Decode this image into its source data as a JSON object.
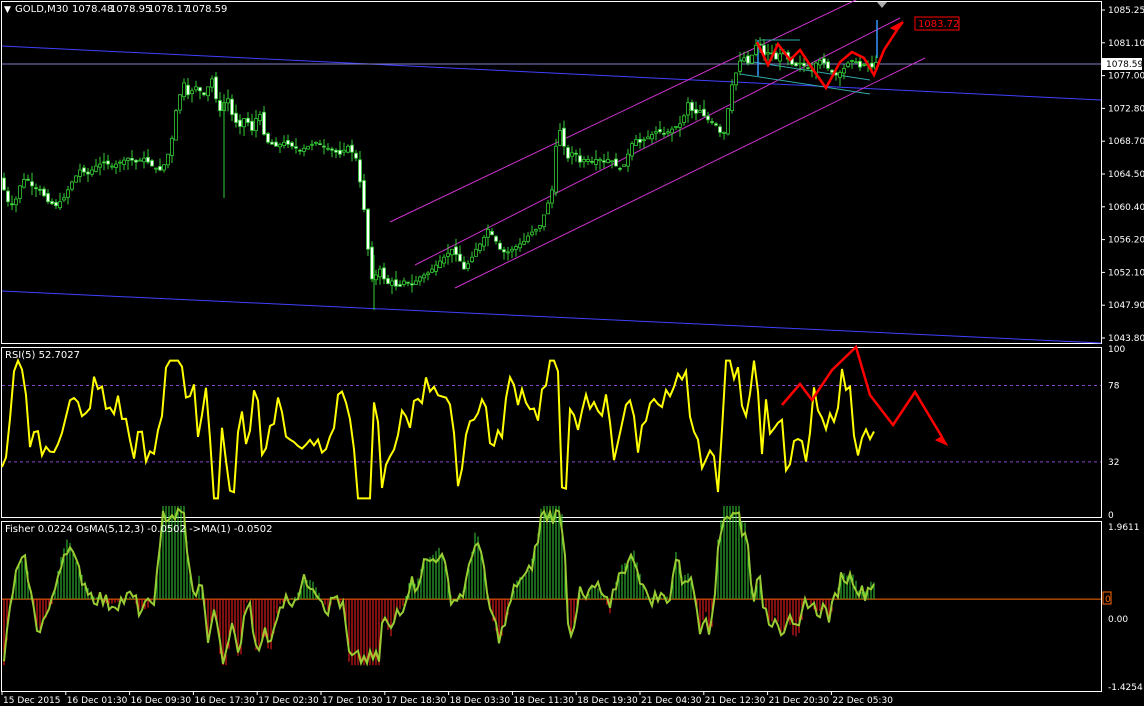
{
  "colors": {
    "background": "#000000",
    "frame": "#ffffff",
    "bull_candle": "#33cc33",
    "bear_candle": "#ffffff",
    "trendline": "#4040ff",
    "channel": "#cc33cc",
    "flag": "#33aaaa",
    "current_price_line": "#8080cc",
    "annotation_red": "#ff0000",
    "rsi_line": "#ffff00",
    "rsi_level": "#8844cc",
    "hist_positive": "#33cc33",
    "hist_negative": "#ff2020",
    "fisher_line": "#99cc33",
    "zero_line": "#ff6a00",
    "text": "#ffffff",
    "target_box_border": "#ff0000"
  },
  "chart_data": [
    {
      "type": "candlestick",
      "title": "GOLD,M30",
      "ohlc_header": [
        "1078.48",
        "1078.95",
        "1078.17",
        "1078.59"
      ],
      "current_price_label": "1078.59",
      "target_label": "1083.72",
      "ylim": [
        1043.8,
        1085.2
      ],
      "y_ticks": [
        "1085.25",
        "1081.10",
        "1077.00",
        "1072.80",
        "1068.70",
        "1064.50",
        "1060.40",
        "1056.20",
        "1052.10",
        "1047.90",
        "1043.80"
      ],
      "x_ticks": [
        "15 Dec 2015",
        "16 Dec 01:30",
        "16 Dec 09:30",
        "16 Dec 17:30",
        "17 Dec 02:30",
        "17 Dec 10:30",
        "17 Dec 18:30",
        "18 Dec 03:30",
        "18 Dec 11:30",
        "18 Dec 19:30",
        "21 Dec 04:30",
        "21 Dec 12:30",
        "21 Dec 20:30",
        "22 Dec 05:30"
      ],
      "close_path": [
        [
          0,
          1064.0
        ],
        [
          8,
          1061.0
        ],
        [
          14,
          1060.5
        ],
        [
          20,
          1063.0
        ],
        [
          26,
          1064.2
        ],
        [
          32,
          1063.0
        ],
        [
          40,
          1062.5
        ],
        [
          48,
          1061.0
        ],
        [
          56,
          1060.5
        ],
        [
          64,
          1061.5
        ],
        [
          72,
          1063.5
        ],
        [
          80,
          1065.0
        ],
        [
          88,
          1064.5
        ],
        [
          96,
          1065.5
        ],
        [
          104,
          1066.0
        ],
        [
          112,
          1065.5
        ],
        [
          120,
          1066.0
        ],
        [
          128,
          1066.5
        ],
        [
          136,
          1066.0
        ],
        [
          144,
          1066.5
        ],
        [
          152,
          1065.5
        ],
        [
          160,
          1065.0
        ],
        [
          166,
          1066.0
        ],
        [
          172,
          1069.0
        ],
        [
          176,
          1072.5
        ],
        [
          180,
          1074.5
        ],
        [
          184,
          1076.0
        ],
        [
          188,
          1074.5
        ],
        [
          192,
          1075.0
        ],
        [
          196,
          1075.5
        ],
        [
          200,
          1075.0
        ],
        [
          204,
          1074.5
        ],
        [
          208,
          1075.5
        ],
        [
          212,
          1076.5
        ],
        [
          216,
          1074.0
        ],
        [
          220,
          1072.5
        ],
        [
          224,
          1073.5
        ],
        [
          228,
          1074.0
        ],
        [
          232,
          1072.0
        ],
        [
          236,
          1071.0
        ],
        [
          240,
          1070.5
        ],
        [
          244,
          1071.5
        ],
        [
          248,
          1071.0
        ],
        [
          252,
          1070.0
        ],
        [
          256,
          1071.5
        ],
        [
          260,
          1072.0
        ],
        [
          264,
          1069.5
        ],
        [
          268,
          1068.5
        ],
        [
          276,
          1068.0
        ],
        [
          284,
          1068.5
        ],
        [
          292,
          1068.0
        ],
        [
          300,
          1067.5
        ],
        [
          308,
          1068.0
        ],
        [
          316,
          1068.5
        ],
        [
          324,
          1068.0
        ],
        [
          332,
          1067.5
        ],
        [
          340,
          1067.0
        ],
        [
          348,
          1068.0
        ],
        [
          356,
          1066.5
        ],
        [
          362,
          1062.0
        ],
        [
          366,
          1058.0
        ],
        [
          370,
          1052.0
        ],
        [
          374,
          1050.5
        ],
        [
          378,
          1053.0
        ],
        [
          382,
          1052.0
        ],
        [
          386,
          1050.5
        ],
        [
          392,
          1051.0
        ],
        [
          398,
          1050.0
        ],
        [
          404,
          1051.0
        ],
        [
          412,
          1050.5
        ],
        [
          420,
          1051.5
        ],
        [
          428,
          1052.0
        ],
        [
          436,
          1053.0
        ],
        [
          444,
          1054.0
        ],
        [
          452,
          1055.0
        ],
        [
          458,
          1054.0
        ],
        [
          464,
          1052.5
        ],
        [
          470,
          1053.5
        ],
        [
          476,
          1055.0
        ],
        [
          482,
          1056.0
        ],
        [
          488,
          1057.5
        ],
        [
          494,
          1056.5
        ],
        [
          500,
          1055.0
        ],
        [
          506,
          1054.5
        ],
        [
          512,
          1055.0
        ],
        [
          518,
          1055.5
        ],
        [
          524,
          1056.0
        ],
        [
          530,
          1057.0
        ],
        [
          536,
          1057.5
        ],
        [
          540,
          1058.0
        ],
        [
          546,
          1060.0
        ],
        [
          552,
          1062.5
        ],
        [
          556,
          1068.0
        ],
        [
          560,
          1070.0
        ],
        [
          564,
          1068.0
        ],
        [
          568,
          1066.5
        ],
        [
          574,
          1067.5
        ],
        [
          580,
          1066.0
        ],
        [
          586,
          1066.5
        ],
        [
          592,
          1066.0
        ],
        [
          598,
          1066.5
        ],
        [
          604,
          1066.0
        ],
        [
          610,
          1066.5
        ],
        [
          616,
          1065.5
        ],
        [
          622,
          1065.0
        ],
        [
          628,
          1067.0
        ],
        [
          634,
          1069.0
        ],
        [
          640,
          1068.5
        ],
        [
          646,
          1069.0
        ],
        [
          652,
          1069.5
        ],
        [
          658,
          1070.0
        ],
        [
          664,
          1069.5
        ],
        [
          670,
          1070.0
        ],
        [
          676,
          1070.5
        ],
        [
          682,
          1071.0
        ],
        [
          688,
          1073.5
        ],
        [
          694,
          1072.0
        ],
        [
          700,
          1072.5
        ],
        [
          706,
          1071.5
        ],
        [
          712,
          1071.0
        ],
        [
          718,
          1070.5
        ],
        [
          722,
          1069.0
        ],
        [
          726,
          1070.5
        ],
        [
          730,
          1075.0
        ],
        [
          734,
          1076.5
        ],
        [
          738,
          1078.0
        ],
        [
          742,
          1079.5
        ],
        [
          748,
          1078.5
        ],
        [
          754,
          1080.0
        ],
        [
          758,
          1081.5
        ],
        [
          764,
          1079.5
        ],
        [
          770,
          1080.0
        ],
        [
          776,
          1079.0
        ],
        [
          782,
          1080.0
        ],
        [
          788,
          1079.0
        ],
        [
          794,
          1078.0
        ],
        [
          800,
          1078.5
        ],
        [
          806,
          1078.0
        ],
        [
          812,
          1077.5
        ],
        [
          818,
          1079.0
        ],
        [
          824,
          1078.5
        ],
        [
          830,
          1077.5
        ],
        [
          836,
          1077.0
        ],
        [
          842,
          1077.5
        ],
        [
          848,
          1078.5
        ],
        [
          854,
          1079.0
        ],
        [
          860,
          1078.0
        ],
        [
          866,
          1078.5
        ],
        [
          872,
          1078.0
        ],
        [
          876,
          1078.59
        ]
      ]
    },
    {
      "type": "line",
      "title": "RSI(5) 52.7027",
      "ylim": [
        0,
        100
      ],
      "y_ticks": [
        "100",
        "78",
        "32",
        "0"
      ],
      "levels": [
        78,
        32
      ]
    },
    {
      "type": "bar",
      "title": "Fisher 0.0224  OsMA(5,12,3) -0.0502  ->MA(1) -0.0502",
      "ylim": [
        -1.4254,
        1.9611
      ],
      "y_ticks": [
        "1.9611",
        "0.00",
        "-1.4254"
      ],
      "zero_marker": "0"
    }
  ]
}
